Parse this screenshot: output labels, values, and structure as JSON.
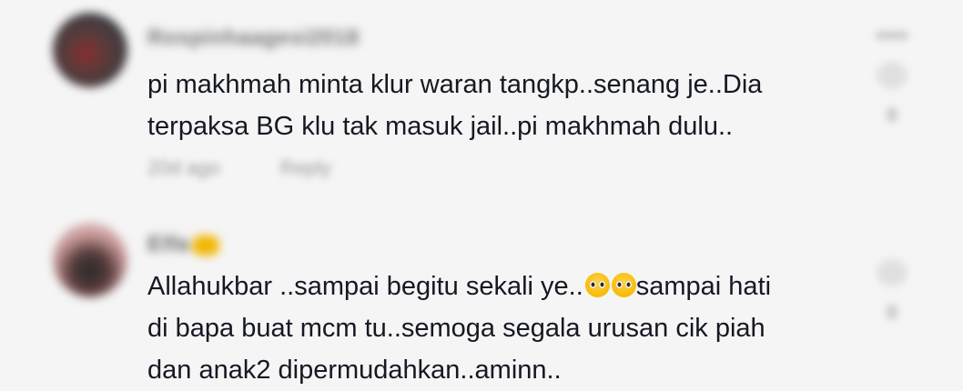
{
  "comments": [
    {
      "username": "Rospinhaagesi2018",
      "text_lines": [
        "pi makhmah minta klur waran tangkp..senang je..Dia",
        "terpaksa BG klu tak masuk jail..pi makhmah dulu.."
      ],
      "time": "20d ago",
      "reply_label": "Reply",
      "like_count": "0"
    },
    {
      "username": "Elfa",
      "text_lines": [
        "Allahukbar ..sampai begitu sekali ye..",
        "sampai hati",
        "di bapa buat mcm tu..semoga segala urusan cik piah",
        "dan anak2 dipermudahkan..aminn.."
      ],
      "emoji": "🥺🥺",
      "like_count": "0"
    }
  ],
  "icons": {
    "avatar": "avatar",
    "more": "more-icon",
    "like": "heart-icon"
  }
}
